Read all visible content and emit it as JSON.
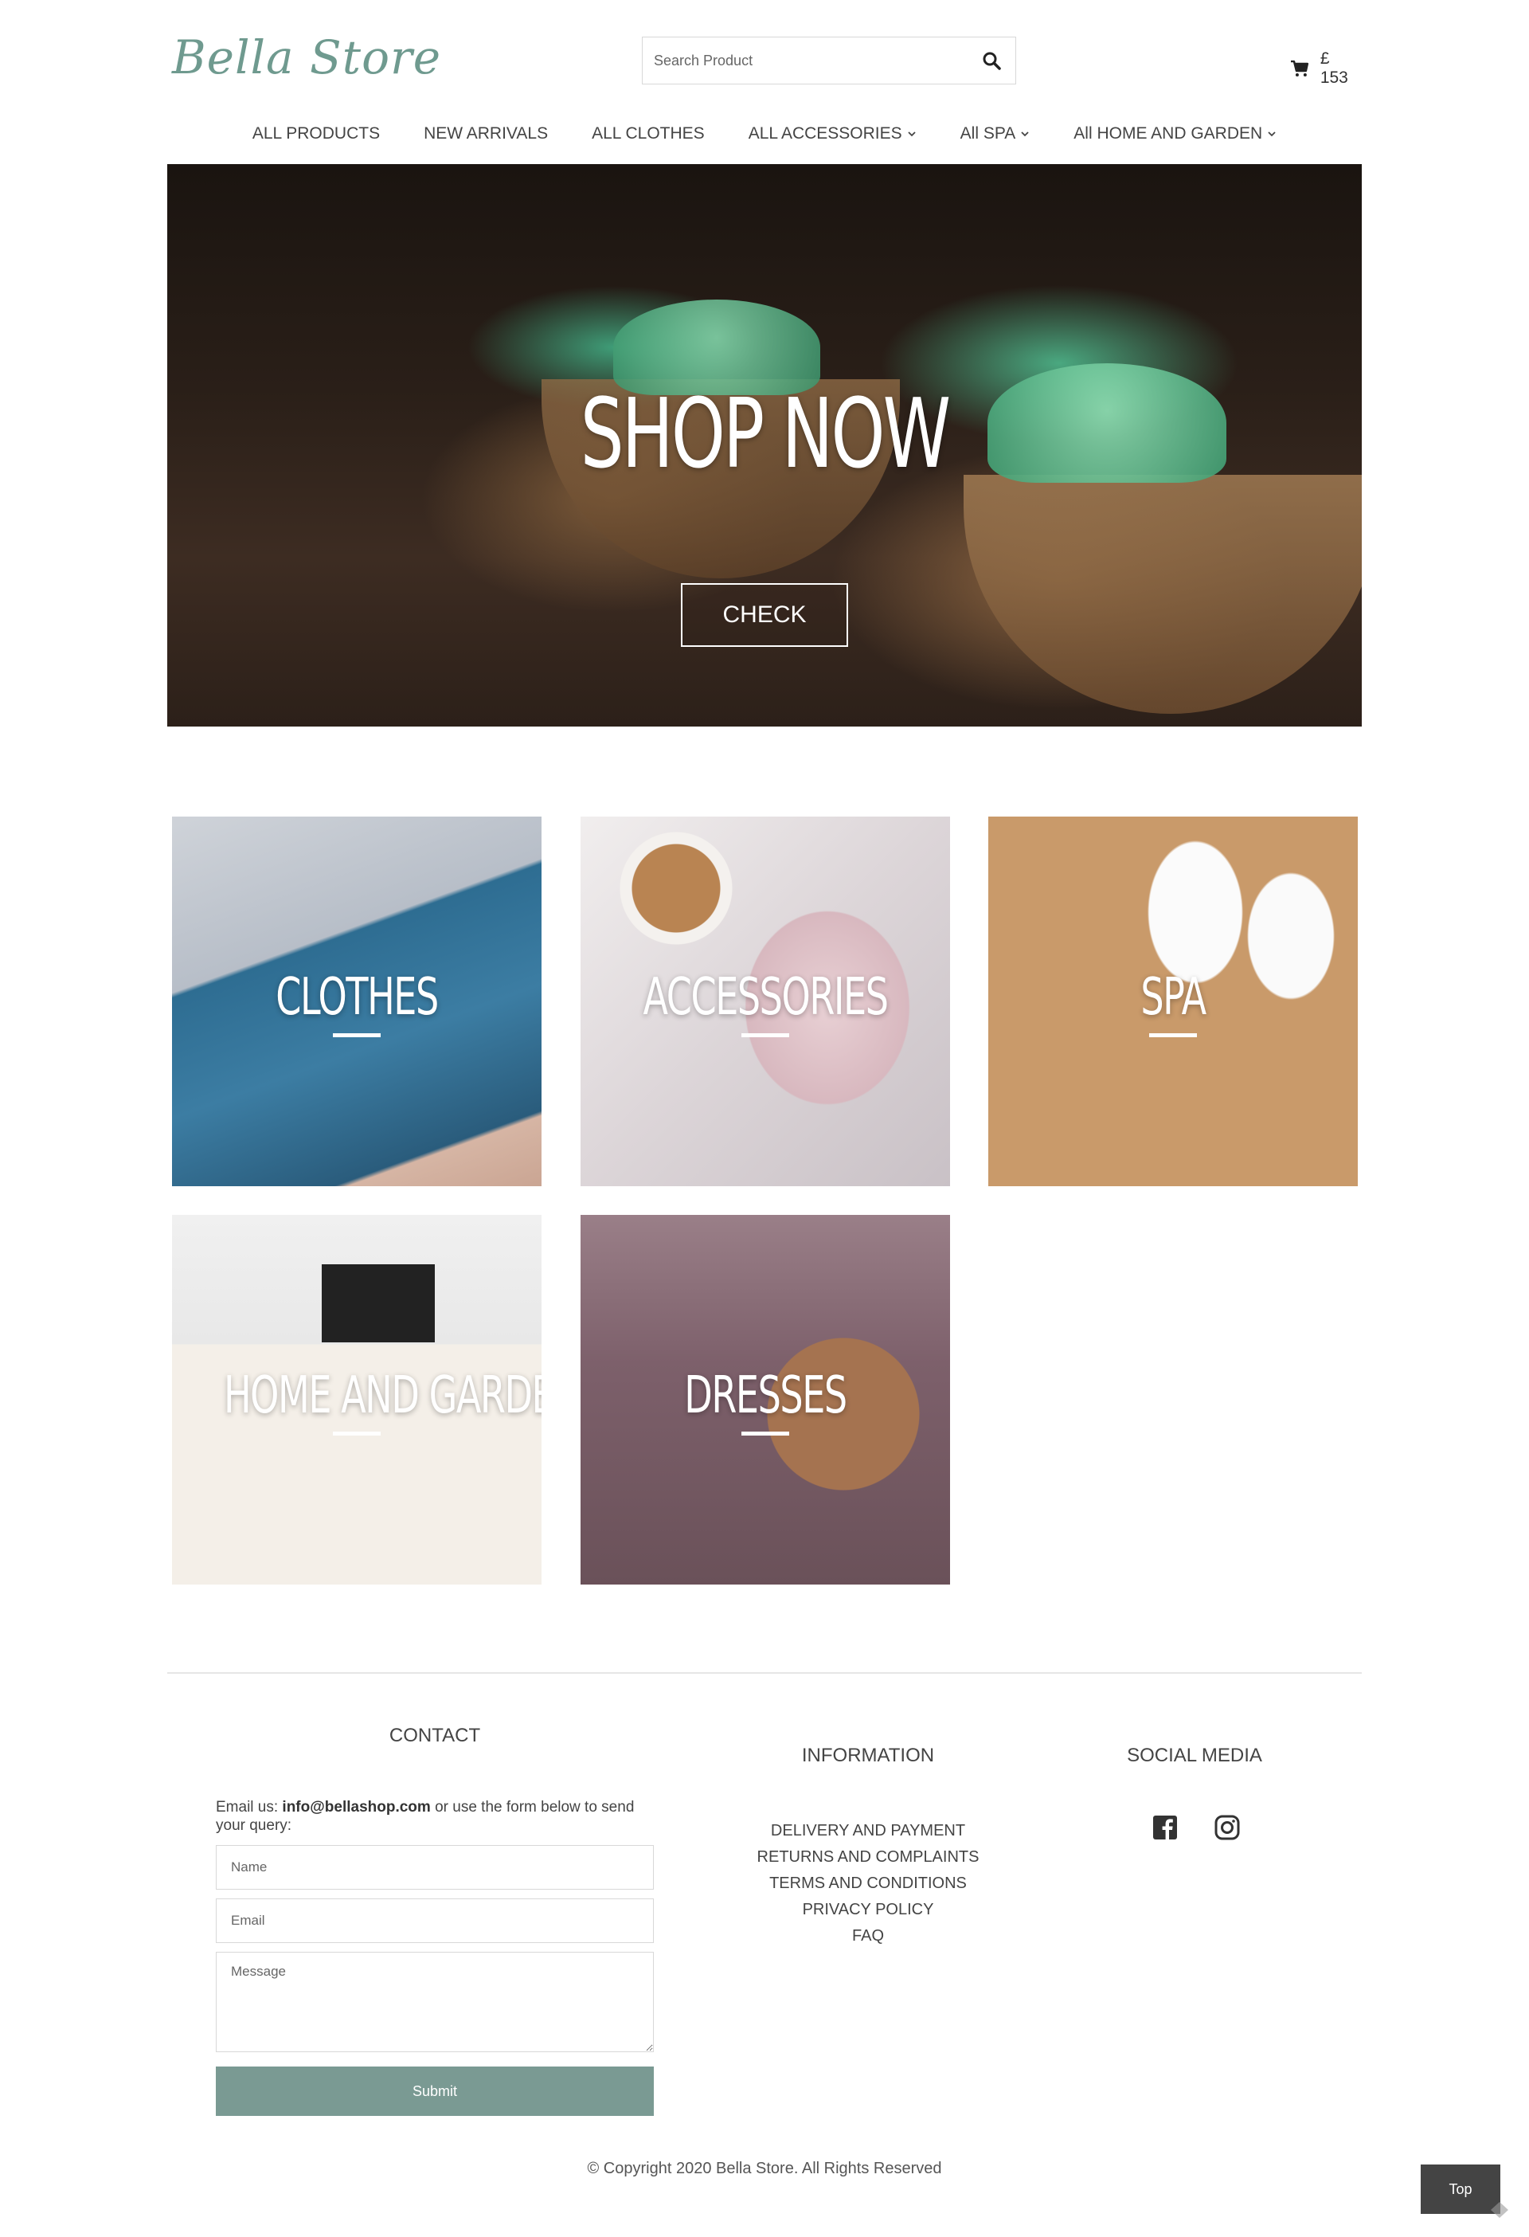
{
  "header": {
    "logo": "Bella Store",
    "search_placeholder": "Search Product",
    "cart_total": "£ 153"
  },
  "nav": {
    "items": [
      {
        "label": "ALL PRODUCTS",
        "dropdown": false
      },
      {
        "label": "NEW ARRIVALS",
        "dropdown": false
      },
      {
        "label": "ALL CLOTHES",
        "dropdown": false
      },
      {
        "label": "ALL ACCESSORIES",
        "dropdown": true
      },
      {
        "label": "All SPA",
        "dropdown": true
      },
      {
        "label": "All HOME AND GARDEN",
        "dropdown": true
      }
    ]
  },
  "hero": {
    "title": "SHOP NOW",
    "button": "CHECK"
  },
  "categories": [
    {
      "label": "CLOTHES"
    },
    {
      "label": "ACCESSORIES"
    },
    {
      "label": "SPA"
    },
    {
      "label": "HOME AND GARDEN"
    },
    {
      "label": "DRESSES"
    }
  ],
  "footer": {
    "contact": {
      "heading": "CONTACT",
      "email_prefix": "Email us:",
      "email": "info@bellashop.com",
      "email_suffix": "or use the form below to send your query:",
      "name_placeholder": "Name",
      "email_placeholder": "Email",
      "message_placeholder": "Message",
      "submit": "Submit"
    },
    "information": {
      "heading": "INFORMATION",
      "links": [
        "DELIVERY AND PAYMENT",
        "RETURNS AND COMPLAINTS",
        "TERMS AND CONDITIONS",
        "PRIVACY POLICY",
        "FAQ"
      ]
    },
    "social": {
      "heading": "SOCIAL MEDIA",
      "icons": [
        "facebook-icon",
        "instagram-icon"
      ]
    },
    "copyright": "© Copyright 2020 Bella Store. All Rights Reserved",
    "top_button": "Top"
  },
  "colors": {
    "accent": "#7a9a93",
    "logo": "#6f9a8f",
    "top_button_bg": "#444444"
  }
}
